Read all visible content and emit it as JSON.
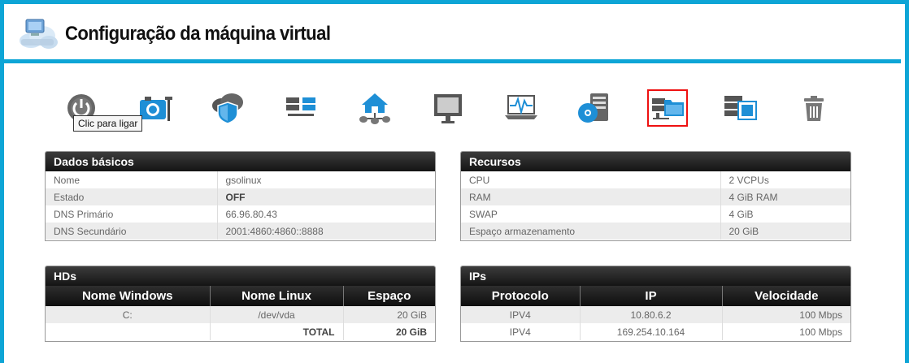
{
  "header": {
    "title": "Configuração da máquina virtual"
  },
  "tooltip": "Clic para ligar",
  "toolbar": {
    "icons": [
      "power-icon",
      "camera-settings-icon",
      "cloud-shield-icon",
      "servers-icon",
      "network-home-icon",
      "monitor-icon",
      "activity-monitor-icon",
      "disk-server-icon",
      "server-folder-icon",
      "server-window-icon",
      "trash-icon"
    ],
    "active": "server-folder-icon"
  },
  "basic": {
    "title": "Dados básicos",
    "rows": [
      {
        "label": "Nome",
        "value": "gsolinux"
      },
      {
        "label": "Estado",
        "value": "OFF"
      },
      {
        "label": "DNS Primário",
        "value": "66.96.80.43"
      },
      {
        "label": "DNS Secundário",
        "value": "2001:4860:4860::8888"
      }
    ]
  },
  "resources": {
    "title": "Recursos",
    "rows": [
      {
        "label": "CPU",
        "value": "2 VCPUs"
      },
      {
        "label": "RAM",
        "value": "4 GiB RAM"
      },
      {
        "label": "SWAP",
        "value": "4 GiB"
      },
      {
        "label": "Espaço armazenamento",
        "value": "20 GiB"
      }
    ]
  },
  "hds": {
    "title": "HDs",
    "columns": [
      "Nome Windows",
      "Nome Linux",
      "Espaço"
    ],
    "rows": [
      {
        "windows": "C:",
        "linux": "/dev/vda",
        "space": "20 GiB"
      }
    ],
    "total_label": "TOTAL",
    "total_value": "20 GiB"
  },
  "ips": {
    "title": "IPs",
    "columns": [
      "Protocolo",
      "IP",
      "Velocidade"
    ],
    "rows": [
      {
        "protocol": "IPV4",
        "ip": "10.80.6.2",
        "speed": "100 Mbps"
      },
      {
        "protocol": "IPV4",
        "ip": "169.254.10.164",
        "speed": "100 Mbps"
      }
    ]
  }
}
